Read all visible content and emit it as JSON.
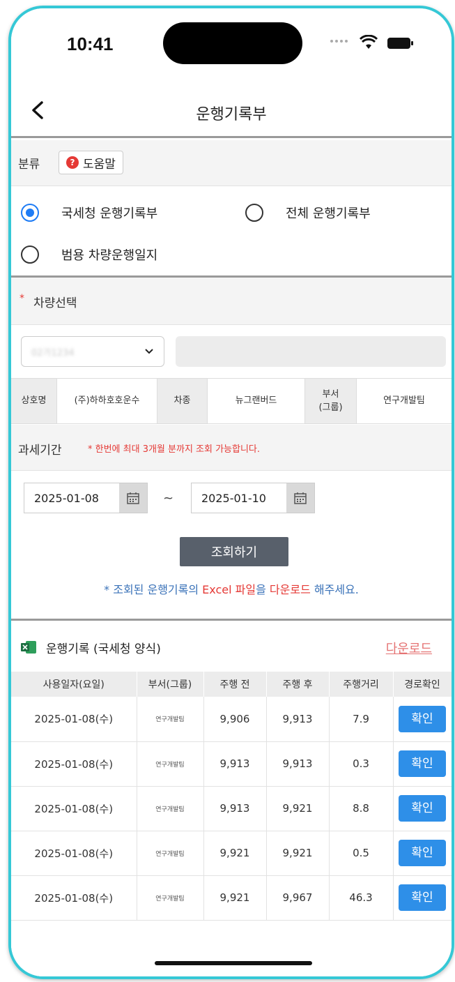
{
  "status": {
    "time": "10:41"
  },
  "nav": {
    "title": "운행기록부"
  },
  "category": {
    "label": "분류",
    "help_label": "도움말",
    "options": [
      {
        "label": "국세청 운행기록부",
        "selected": true
      },
      {
        "label": "전체 운행기록부",
        "selected": false
      },
      {
        "label": "범용 차량운행일지",
        "selected": false
      }
    ]
  },
  "vehicle": {
    "required_mark": "*",
    "label": "차량선택",
    "selected_value": "02가1234",
    "model_value": ""
  },
  "info": {
    "company_label": "상호명",
    "company_value": "(주)하하호호운수",
    "car_type_label": "차종",
    "car_type_value": "뉴그랜버드",
    "dept_label": "부서\n(그룹)",
    "dept_value": "연구개발팀"
  },
  "period": {
    "label": "과세기간",
    "note": "* 한번에 최대 3개월 분까지 조회 가능합니다.",
    "start": "2025-01-08",
    "tilde": "~",
    "end": "2025-01-10"
  },
  "query_button": "조회하기",
  "download_note": {
    "part1": "* 조회된 운행기록의 ",
    "part2": "Excel 파일",
    "part3": "을 ",
    "part4": "다운로드",
    "part5": " 해주세요."
  },
  "records": {
    "title": "운행기록 (국세청 양식)",
    "download_label": "다운로드",
    "columns": [
      "사용일자(요일)",
      "부서(그룹)",
      "주행 전",
      "주행 후",
      "주행거리",
      "경로확인"
    ],
    "rows": [
      {
        "date": "2025-01-08(수)",
        "dept": "연구개발팀",
        "before": "9,906",
        "after": "9,913",
        "distance": "7.9",
        "action": "확인"
      },
      {
        "date": "2025-01-08(수)",
        "dept": "연구개발팀",
        "before": "9,913",
        "after": "9,913",
        "distance": "0.3",
        "action": "확인"
      },
      {
        "date": "2025-01-08(수)",
        "dept": "연구개발팀",
        "before": "9,913",
        "after": "9,921",
        "distance": "8.8",
        "action": "확인"
      },
      {
        "date": "2025-01-08(수)",
        "dept": "연구개발팀",
        "before": "9,921",
        "after": "9,921",
        "distance": "0.5",
        "action": "확인"
      },
      {
        "date": "2025-01-08(수)",
        "dept": "연구개발팀",
        "before": "9,921",
        "after": "9,967",
        "distance": "46.3",
        "action": "확인"
      }
    ]
  },
  "colors": {
    "accent": "#1e7cf5",
    "confirm": "#2e8fe8",
    "warning": "#e53935",
    "device_frame": "#35c8d6"
  }
}
